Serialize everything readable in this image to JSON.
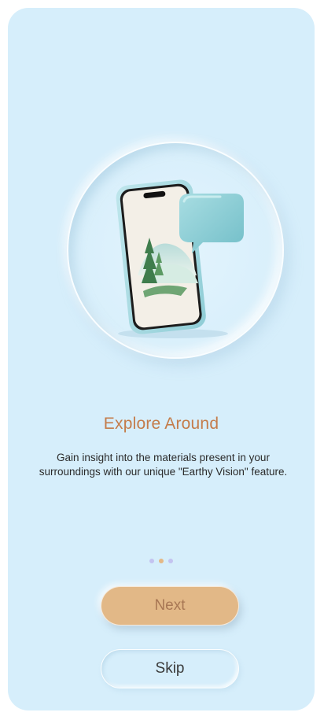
{
  "onboarding": {
    "title": "Explore Around",
    "description": "Gain insight into the materials present in your surroundings with our unique \"Earthy Vision\" feature.",
    "pagination": {
      "total": 3,
      "active_index": 1
    },
    "next_label": "Next",
    "skip_label": "Skip"
  },
  "colors": {
    "background": "#d6eefb",
    "title": "#c47c4a",
    "next_button": "#e2b887",
    "dot_inactive": "#c3c3f0",
    "dot_active": "#e4b886"
  },
  "icons": {
    "illustration": "phone-with-speech-bubble-illustration"
  }
}
